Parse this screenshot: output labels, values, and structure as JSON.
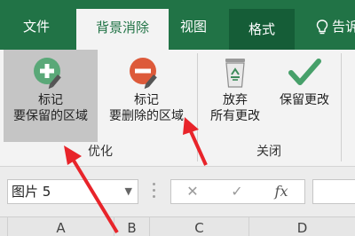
{
  "tabs": {
    "file": "文件",
    "background_removal": "背景消除",
    "view": "视图",
    "format": "格式",
    "tell_me": "告诉"
  },
  "ribbon": {
    "mark_keep": {
      "line1": "标记",
      "line2": "要保留的区域",
      "icon": "plus-circle-pencil-icon"
    },
    "mark_remove": {
      "line1": "标记",
      "line2": "要删除的区域",
      "icon": "minus-circle-pencil-icon"
    },
    "discard_changes": {
      "line1": "放弃",
      "line2": "所有更改",
      "icon": "recycle-bin-icon"
    },
    "keep_changes": {
      "line1": "保留更改",
      "icon": "checkmark-icon"
    },
    "group_refine": "优化",
    "group_close": "关闭"
  },
  "formula_bar": {
    "name_box": "图片 5",
    "cancel_glyph": "✕",
    "enter_glyph": "✓",
    "fx_glyph": "fx"
  },
  "columns": [
    "A",
    "B",
    "C",
    "D"
  ],
  "colors": {
    "accent": "#217346",
    "format_tab": "#155d37",
    "annotation_arrow": "#e8242a"
  }
}
